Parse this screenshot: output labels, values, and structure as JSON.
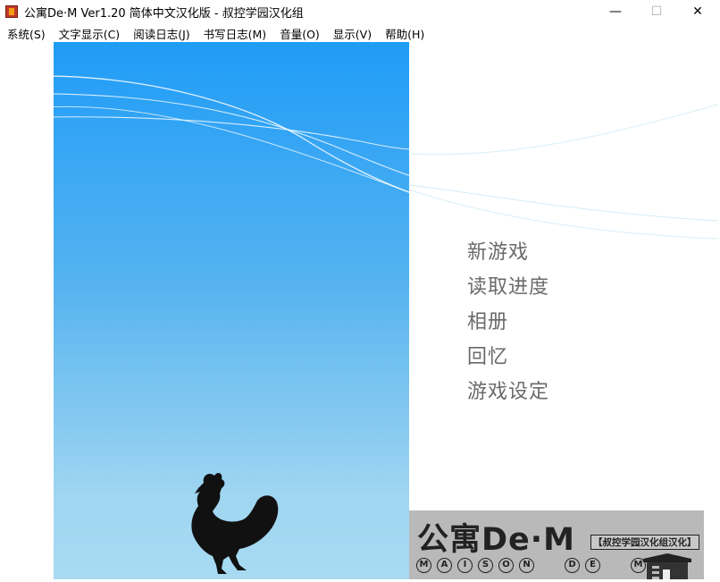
{
  "window": {
    "title": "公寓De·M Ver1.20 简体中文汉化版 - 叔控学园汉化组",
    "minimize": "—",
    "maximize": "☐",
    "close": "✕"
  },
  "menubar": {
    "items": [
      {
        "label": "系统(S)"
      },
      {
        "label": "文字显示(C)"
      },
      {
        "label": "阅读日志(J)"
      },
      {
        "label": "书写日志(M)"
      },
      {
        "label": "音量(O)"
      },
      {
        "label": "显示(V)"
      },
      {
        "label": "帮助(H)"
      }
    ]
  },
  "title_menu": {
    "items": [
      {
        "label": "新游戏"
      },
      {
        "label": "读取进度"
      },
      {
        "label": "相册"
      },
      {
        "label": "回忆"
      },
      {
        "label": "游戏设定"
      }
    ]
  },
  "logo": {
    "main": "公寓De·M",
    "sub": "【叔控学园汉化组汉化】",
    "letters_left": [
      "M",
      "A",
      "I",
      "S",
      "O",
      "N"
    ],
    "letters_mid": [
      "D",
      "E"
    ],
    "letters_right": [
      "M"
    ]
  },
  "colors": {
    "sky_top": "#1f9cf7",
    "sky_bottom": "#a8daf2",
    "menu_text": "#6a6a6a",
    "logo_bg": "#b9b9b9"
  }
}
